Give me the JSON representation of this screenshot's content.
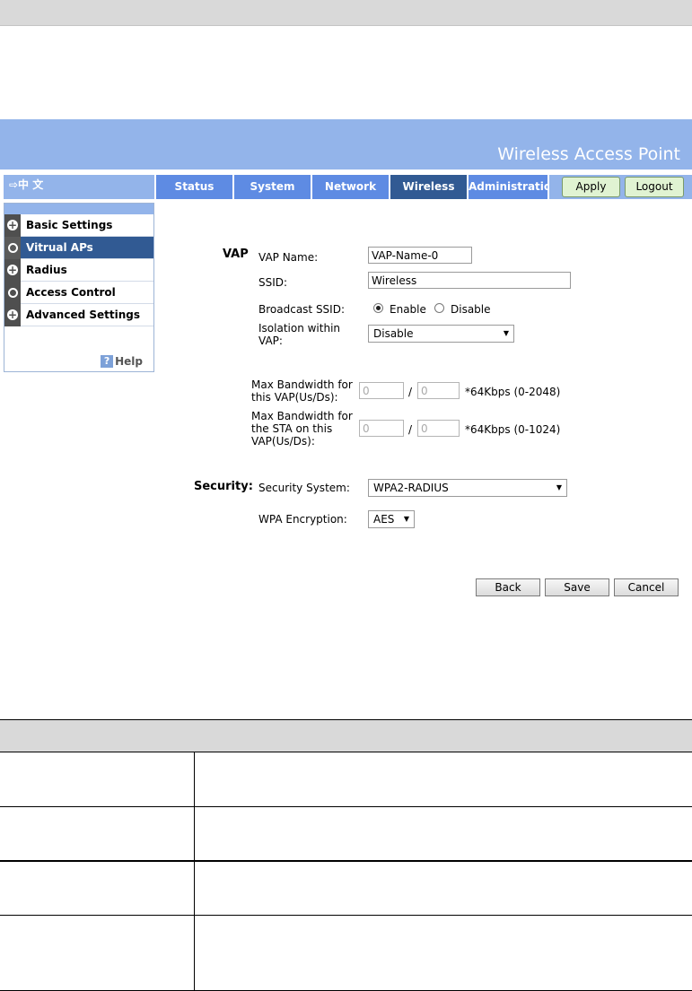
{
  "banner": {
    "title": "Wireless Access Point"
  },
  "lang": {
    "label": "⇨中  文"
  },
  "tabs": [
    {
      "label": "Status"
    },
    {
      "label": "System"
    },
    {
      "label": "Network"
    },
    {
      "label": "Wireless"
    },
    {
      "label": "Administration"
    }
  ],
  "header_buttons": {
    "apply": "Apply",
    "logout": "Logout"
  },
  "sidebar": {
    "items": [
      {
        "label": "Basic Settings",
        "icon": "plus-circle-icon"
      },
      {
        "label": "Vitrual APs",
        "icon": "circle-icon"
      },
      {
        "label": "Radius",
        "icon": "plus-circle-icon"
      },
      {
        "label": "Access Control",
        "icon": "circle-icon"
      },
      {
        "label": "Advanced Settings",
        "icon": "plus-circle-icon"
      }
    ],
    "help": "Help"
  },
  "form": {
    "vap_section": "VAP",
    "vap_name_label": "VAP Name:",
    "vap_name_value": "VAP-Name-0",
    "ssid_label": "SSID:",
    "ssid_value": "Wireless",
    "broadcast_label": "Broadcast SSID:",
    "broadcast_enable": "Enable",
    "broadcast_disable": "Disable",
    "isolation_label_1": "Isolation within",
    "isolation_label_2": "VAP:",
    "isolation_value": "Disable",
    "bw_vap_label_1": "Max Bandwidth for",
    "bw_vap_label_2": "this VAP(Us/Ds):",
    "bw_vap_us": "0",
    "bw_vap_ds": "0",
    "bw_vap_unit": "*64Kbps (0-2048)",
    "bw_sta_label_1": "Max Bandwidth for",
    "bw_sta_label_2": "the STA on this",
    "bw_sta_label_3": "VAP(Us/Ds):",
    "bw_sta_us": "0",
    "bw_sta_ds": "0",
    "bw_sta_unit": "*64Kbps (0-1024)",
    "slash": "/",
    "security_section": "Security:",
    "security_system_label": "Security System:",
    "security_system_value": "WPA2-RADIUS",
    "wpa_encryption_label": "WPA Encryption:",
    "wpa_encryption_value": "AES"
  },
  "buttons": {
    "back": "Back",
    "save": "Save",
    "cancel": "Cancel"
  },
  "colors": {
    "banner": "#93b4ea",
    "tab": "#5e8be3",
    "tab_active": "#315a93",
    "header_button": "#e0f3d2"
  }
}
